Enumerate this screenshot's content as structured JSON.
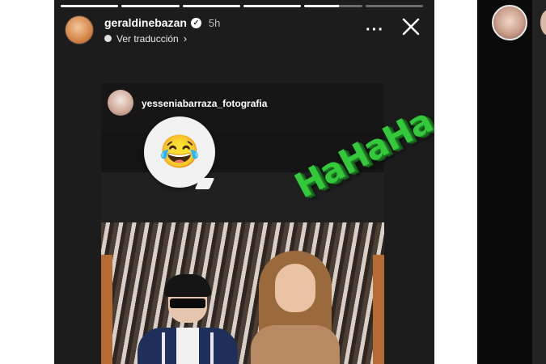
{
  "story": {
    "progress": [
      1,
      1,
      1,
      1,
      0.6,
      0
    ],
    "username": "geraldinebazan",
    "time": "5h",
    "translate_label": "Ver traducción",
    "reshared_username": "yesseniabarraza_fotografia",
    "emoji": "😂",
    "sticker_text": "HaHaHa",
    "more_icon": "···"
  },
  "colors": {
    "background": "#1c1c1c",
    "sticker": "#33c93a"
  }
}
